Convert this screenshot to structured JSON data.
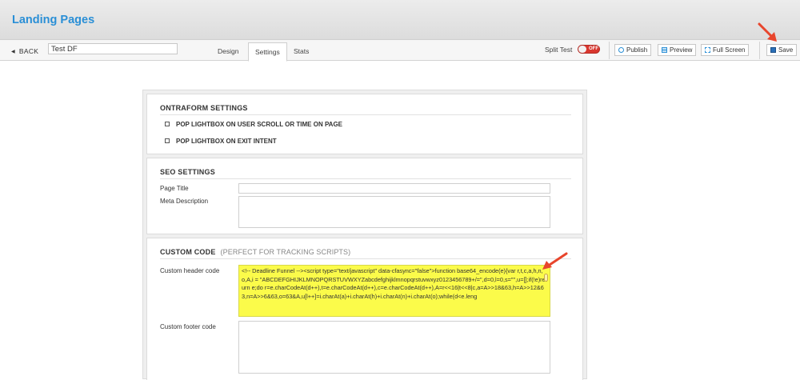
{
  "header": {
    "title": "Landing Pages"
  },
  "toolbar": {
    "back_label": "BACK",
    "page_name": "Test DF",
    "tabs": [
      {
        "label": "Design"
      },
      {
        "label": "Settings",
        "active": true
      },
      {
        "label": "Stats"
      }
    ],
    "split_test_label": "Split Test",
    "split_test_state": "OFF",
    "publish_label": "Publish",
    "preview_label": "Preview",
    "fullscreen_label": "Full Screen",
    "save_label": "Save"
  },
  "ontraform": {
    "title": "ONTRAFORM SETTINGS",
    "options": [
      {
        "label": "POP LIGHTBOX ON USER SCROLL OR TIME ON PAGE",
        "checked": false
      },
      {
        "label": "POP LIGHTBOX ON EXIT INTENT",
        "checked": false
      }
    ]
  },
  "seo": {
    "title": "SEO SETTINGS",
    "page_title_label": "Page Title",
    "page_title_value": "",
    "meta_description_label": "Meta Description",
    "meta_description_value": ""
  },
  "custom_code": {
    "title": "CUSTOM CODE",
    "subtitle": "(PERFECT FOR TRACKING SCRIPTS)",
    "header_label": "Custom header code",
    "header_value": "<!-- Deadline Funnel --><script type=\"text/javascript\" data-cfasync=\"false\">function base64_encode(e){var r,t,c,a,h,n,o,A,i = \"ABCDEFGHIJKLMNOPQRSTUVWXYZabcdefghijklmnopqrstuvwxyz0123456789+/=\",d=0,l=0,s=\"\",u=[];if(!e)return e;do r=e.charCodeAt(d++),t=e.charCodeAt(d++),c=e.charCodeAt(d++),A=r<<16|t<<8|c,a=A>>18&63,h=A>>12&63,n=A>>6&63,o=63&A,u[l++]=i.charAt(a)+i.charAt(h)+i.charAt(n)+i.charAt(o);while(d<e.leng",
    "footer_label": "Custom footer code",
    "footer_value": ""
  },
  "colors": {
    "accent": "#2a8fd6",
    "highlight": "#fbfb4a",
    "annotation_arrow": "#e8452c",
    "toggle_off": "#d9372f"
  }
}
